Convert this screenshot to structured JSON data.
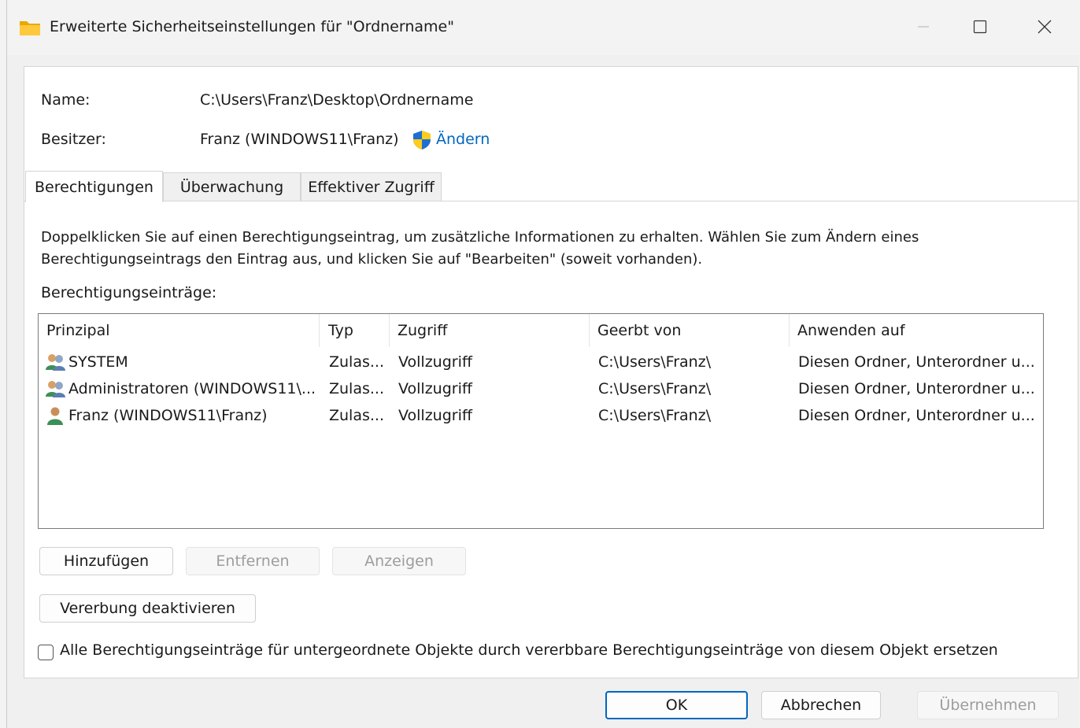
{
  "window": {
    "title": "Erweiterte Sicherheitseinstellungen für \"Ordnername\"",
    "icon": "folder-icon"
  },
  "info": {
    "name_label": "Name:",
    "name_value": "C:\\Users\\Franz\\Desktop\\Ordnername",
    "owner_label": "Besitzer:",
    "owner_value": "Franz (WINDOWS11\\Franz)",
    "change_link": "Ändern"
  },
  "tabs": [
    {
      "label": "Berechtigungen",
      "active": true
    },
    {
      "label": "Überwachung",
      "active": false
    },
    {
      "label": "Effektiver Zugriff",
      "active": false
    }
  ],
  "description": "Doppelklicken Sie auf einen Berechtigungseintrag, um zusätzliche Informationen zu erhalten. Wählen Sie zum Ändern eines Berechtigungseintrags den Eintrag aus, und klicken Sie auf \"Bearbeiten\" (soweit vorhanden).",
  "entries_label": "Berechtigungseinträge:",
  "columns": [
    "Prinzipal",
    "Typ",
    "Zugriff",
    "Geerbt von",
    "Anwenden auf"
  ],
  "rows": [
    {
      "principal": "SYSTEM",
      "icon": "user-group-icon",
      "type": "Zulas...",
      "access": "Vollzugriff",
      "inherited": "C:\\Users\\Franz\\",
      "applies": "Diesen Ordner, Unterordner u..."
    },
    {
      "principal": "Administratoren (WINDOWS11\\...",
      "icon": "user-group-icon",
      "type": "Zulas...",
      "access": "Vollzugriff",
      "inherited": "C:\\Users\\Franz\\",
      "applies": "Diesen Ordner, Unterordner u..."
    },
    {
      "principal": "Franz (WINDOWS11\\Franz)",
      "icon": "user-icon",
      "type": "Zulas...",
      "access": "Vollzugriff",
      "inherited": "C:\\Users\\Franz\\",
      "applies": "Diesen Ordner, Unterordner u..."
    }
  ],
  "buttons": {
    "add": "Hinzufügen",
    "remove": "Entfernen",
    "view": "Anzeigen",
    "disable_inheritance": "Vererbung deaktivieren",
    "ok": "OK",
    "cancel": "Abbrechen",
    "apply": "Übernehmen"
  },
  "replace_checkbox": {
    "label": "Alle Berechtigungseinträge für untergeordnete Objekte durch vererbbare Berechtigungseinträge von diesem Objekt ersetzen",
    "checked": false
  },
  "colors": {
    "accent": "#0067c0",
    "folder": "#f4b400"
  }
}
